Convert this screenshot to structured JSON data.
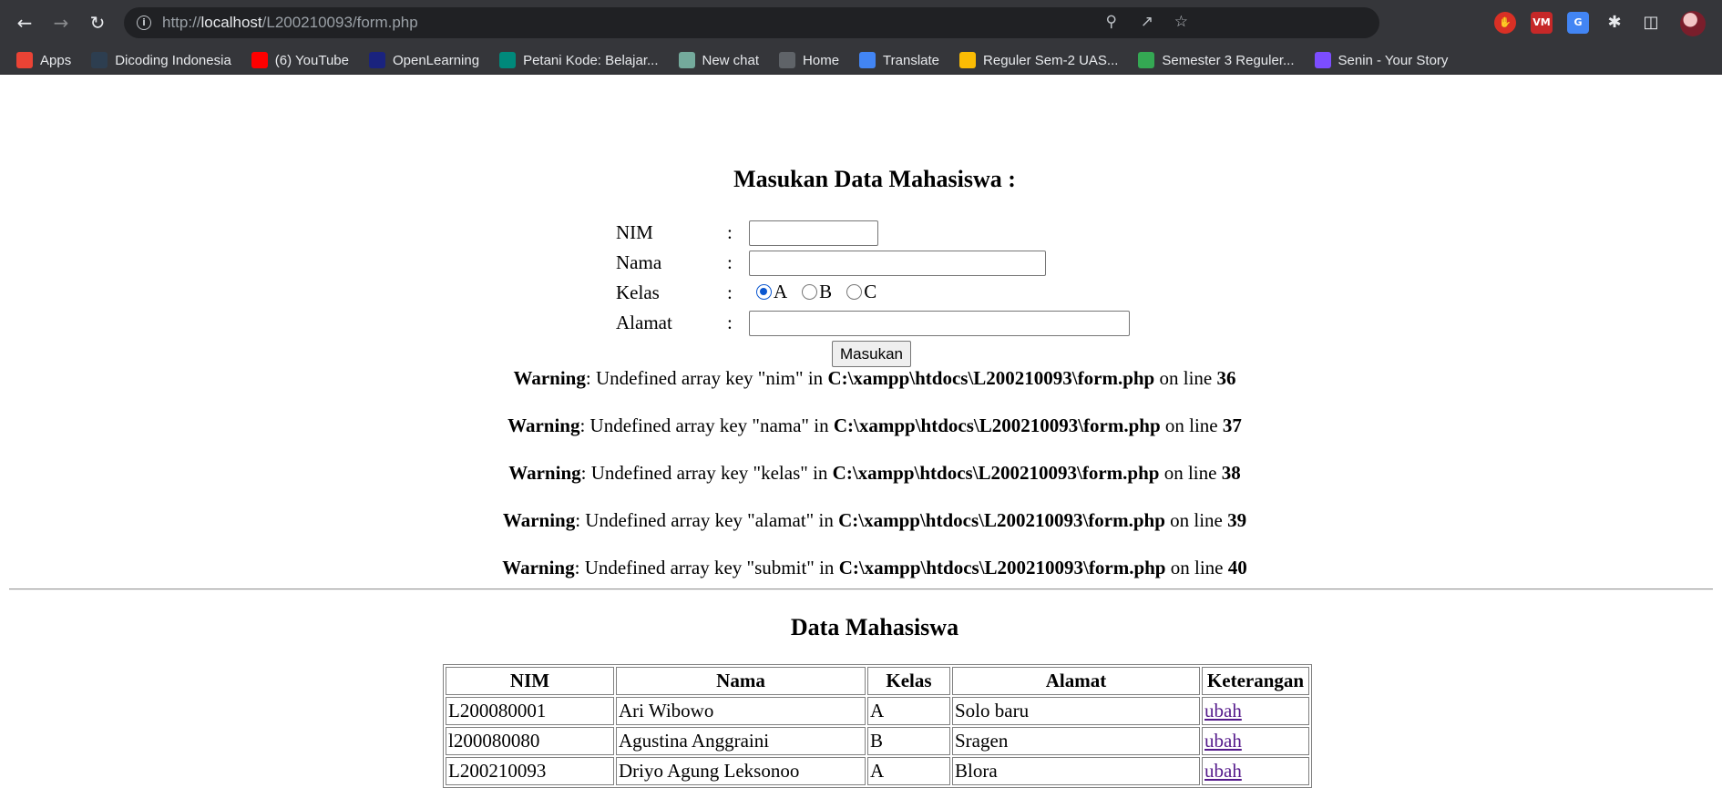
{
  "browser": {
    "url_prefix": "http://",
    "url_host": "localhost",
    "url_path": "/L200210093/form.php",
    "bookmarks": [
      {
        "label": "Apps",
        "icon": "apps-grid-icon",
        "color": "#ea4335"
      },
      {
        "label": "Dicoding Indonesia",
        "icon": "dicoding-icon",
        "color": "#2d3e50"
      },
      {
        "label": "(6) YouTube",
        "icon": "youtube-icon",
        "color": "#ff0000"
      },
      {
        "label": "OpenLearning",
        "icon": "openlearning-icon",
        "color": "#1a237e"
      },
      {
        "label": "Petani Kode: Belajar...",
        "icon": "petanikode-icon",
        "color": "#00897b"
      },
      {
        "label": "New chat",
        "icon": "chatgpt-icon",
        "color": "#74aa9c"
      },
      {
        "label": "Home",
        "icon": "skype-home-icon",
        "color": "#5f6368"
      },
      {
        "label": "Translate",
        "icon": "google-translate-icon",
        "color": "#4285f4"
      },
      {
        "label": "Reguler Sem-2 UAS...",
        "icon": "google-drive-icon",
        "color": "#fbbc04"
      },
      {
        "label": "Semester 3 Reguler...",
        "icon": "google-drive-icon",
        "color": "#34a853"
      },
      {
        "label": "Senin - Your Story",
        "icon": "heart-icon",
        "color": "#7c4dff"
      }
    ]
  },
  "form": {
    "title": "Masukan Data Mahasiswa :",
    "colon": ":",
    "fields": {
      "nim_label": "NIM",
      "nama_label": "Nama",
      "kelas_label": "Kelas",
      "alamat_label": "Alamat",
      "nim_value": "",
      "nama_value": "",
      "alamat_value": ""
    },
    "kelas_options": [
      {
        "label": "A",
        "checked": true
      },
      {
        "label": "B",
        "checked": false
      },
      {
        "label": "C",
        "checked": false
      }
    ],
    "submit_label": "Masukan"
  },
  "warnings": [
    {
      "prefix": "Warning",
      "message": ": Undefined array key \"nim\" in ",
      "file": "C:\\xampp\\htdocs\\L200210093\\form.php",
      "on_line": " on line ",
      "line": "36"
    },
    {
      "prefix": "Warning",
      "message": ": Undefined array key \"nama\" in ",
      "file": "C:\\xampp\\htdocs\\L200210093\\form.php",
      "on_line": " on line ",
      "line": "37"
    },
    {
      "prefix": "Warning",
      "message": ": Undefined array key \"kelas\" in ",
      "file": "C:\\xampp\\htdocs\\L200210093\\form.php",
      "on_line": " on line ",
      "line": "38"
    },
    {
      "prefix": "Warning",
      "message": ": Undefined array key \"alamat\" in ",
      "file": "C:\\xampp\\htdocs\\L200210093\\form.php",
      "on_line": " on line ",
      "line": "39"
    },
    {
      "prefix": "Warning",
      "message": ": Undefined array key \"submit\" in ",
      "file": "C:\\xampp\\htdocs\\L200210093\\form.php",
      "on_line": " on line ",
      "line": "40"
    }
  ],
  "data_section": {
    "title": "Data Mahasiswa",
    "headers": [
      "NIM",
      "Nama",
      "Kelas",
      "Alamat",
      "Keterangan"
    ],
    "rows": [
      {
        "nim": "L200080001",
        "nama": "Ari Wibowo",
        "kelas": "A",
        "alamat": "Solo baru",
        "link": "ubah"
      },
      {
        "nim": "l200080080",
        "nama": "Agustina Anggraini",
        "kelas": "B",
        "alamat": "Sragen",
        "link": "ubah"
      },
      {
        "nim": "L200210093",
        "nama": "Driyo Agung Leksonoo",
        "kelas": "A",
        "alamat": "Blora",
        "link": "ubah"
      }
    ]
  }
}
